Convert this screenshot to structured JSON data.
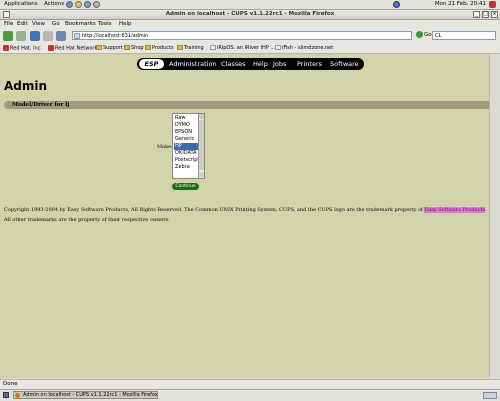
{
  "panel": {
    "menus": [
      "Applications",
      "Actions"
    ],
    "clock": "Mon 21 Feb, 20:41"
  },
  "window": {
    "title": "Admin on localhost - CUPS v1.1.22rc1 - Mozilla Firefox"
  },
  "menubar": {
    "items": [
      "File",
      "Edit",
      "View",
      "Go",
      "Bookmarks",
      "Tools",
      "Help"
    ]
  },
  "toolbar": {
    "url": "http://localhost:631/admin",
    "go_label": "Go",
    "search_value": "CL"
  },
  "bookmarks": {
    "items": [
      "Red Hat, Inc.",
      "Red Hat Network",
      "Support",
      "Shop",
      "Products",
      "Training",
      "iRipOS: an iRiver iHP ...",
      "iFish - slimdzone.net"
    ]
  },
  "nav": {
    "esp": "ESP",
    "tabs": [
      "Administration",
      "Classes",
      "Help",
      "Jobs",
      "Printers",
      "Software"
    ]
  },
  "page": {
    "title": "Admin",
    "section_title": "Model/Driver for lj",
    "make_label": "Make:",
    "make_options": [
      "Raw",
      "DYMO",
      "EPSON",
      "Generic",
      "HP",
      "OKIDATA",
      "Postscript",
      "Zebra"
    ],
    "selected_make": "HP",
    "continue_label": "Continue",
    "copyright_before": "Copyright 1993-2004 by Easy Software Products, All Rights Reserved. The Common UNIX Printing System, CUPS, and the CUPS logo are the trademark property of ",
    "copyright_link": "Easy Software Products",
    "copyright_after": ". All other trademarks are the property of their respective owners."
  },
  "status": {
    "text": "Done"
  },
  "taskbar": {
    "item": "Admin on localhost - CUPS v1.1.22rc1 - Mozilla Firefox"
  },
  "colors": {
    "content_bg": "#d3d3aa",
    "section_bar": "#9e9c7a",
    "nav_bar": "#000000",
    "continue_button": "#1f6b1f",
    "selection": "#3d6aa5",
    "link_highlight": "#d47fd4"
  }
}
